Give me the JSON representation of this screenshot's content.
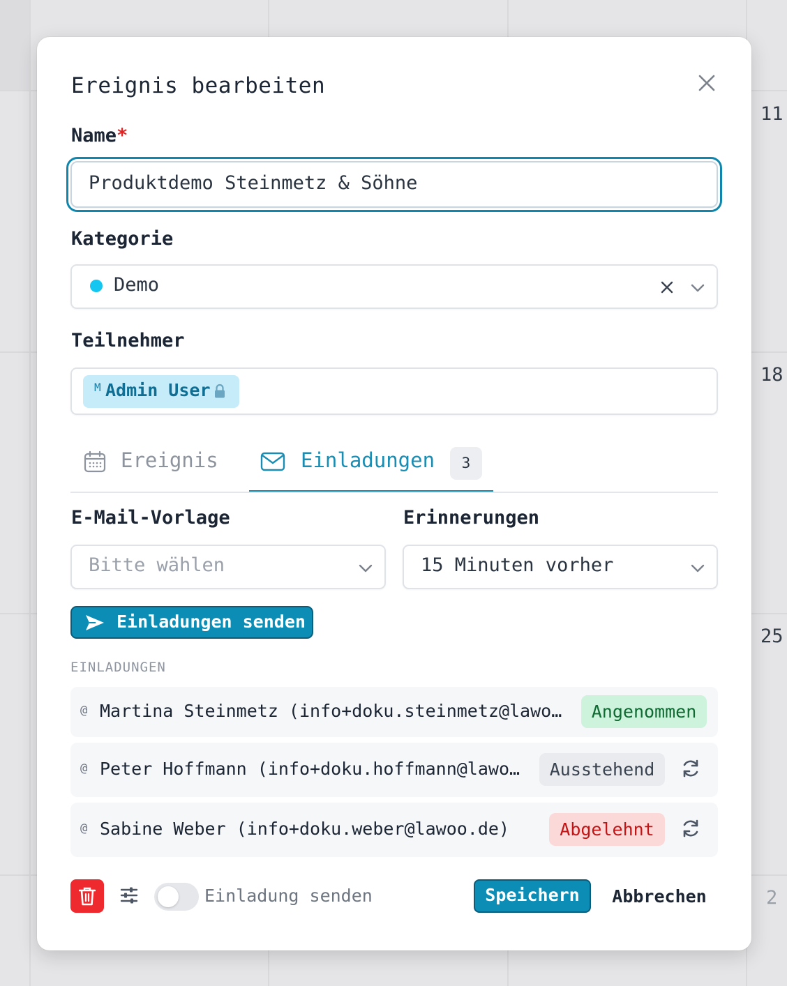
{
  "background": {
    "day_numbers": [
      "11",
      "18",
      "25",
      "2"
    ]
  },
  "modal": {
    "title": "Ereignis bearbeiten",
    "name": {
      "label": "Name",
      "required_mark": "*",
      "value": "Produktdemo Steinmetz & Söhne"
    },
    "category": {
      "label": "Kategorie",
      "value": "Demo",
      "dot_color": "#14c6f0"
    },
    "participants": {
      "label": "Teilnehmer",
      "chips": [
        {
          "prefix": "M",
          "name": "Admin User"
        }
      ]
    },
    "tabs": [
      {
        "label": "Ereignis",
        "icon": "calendar-icon",
        "active": false
      },
      {
        "label": "Einladungen",
        "icon": "mail-icon",
        "active": true,
        "badge": "3"
      }
    ],
    "email_template": {
      "label": "E-Mail-Vorlage",
      "placeholder": "Bitte wählen"
    },
    "reminders": {
      "label": "Erinnerungen",
      "value": "15 Minuten vorher"
    },
    "send_invites_button": "Einladungen senden",
    "invitations_heading": "EINLADUNGEN",
    "invitations": [
      {
        "at": "@",
        "name": "Martina Steinmetz (info+doku.steinmetz@lawoo…",
        "status": "Angenommen",
        "status_type": "accepted"
      },
      {
        "at": "@",
        "name": "Peter Hoffmann (info+doku.hoffmann@lawoo…",
        "status": "Ausstehend",
        "status_type": "pending"
      },
      {
        "at": "@",
        "name": "Sabine Weber (info+doku.weber@lawoo.de)",
        "status": "Abgelehnt",
        "status_type": "declined"
      }
    ],
    "footer": {
      "send_invite_toggle_label": "Einladung senden",
      "send_invite_toggle_on": false,
      "save_label": "Speichern",
      "cancel_label": "Abbrechen"
    }
  },
  "colors": {
    "primary": "#0b8db6",
    "danger": "#ee2a2f",
    "focus_ring": "#0e86ad"
  }
}
